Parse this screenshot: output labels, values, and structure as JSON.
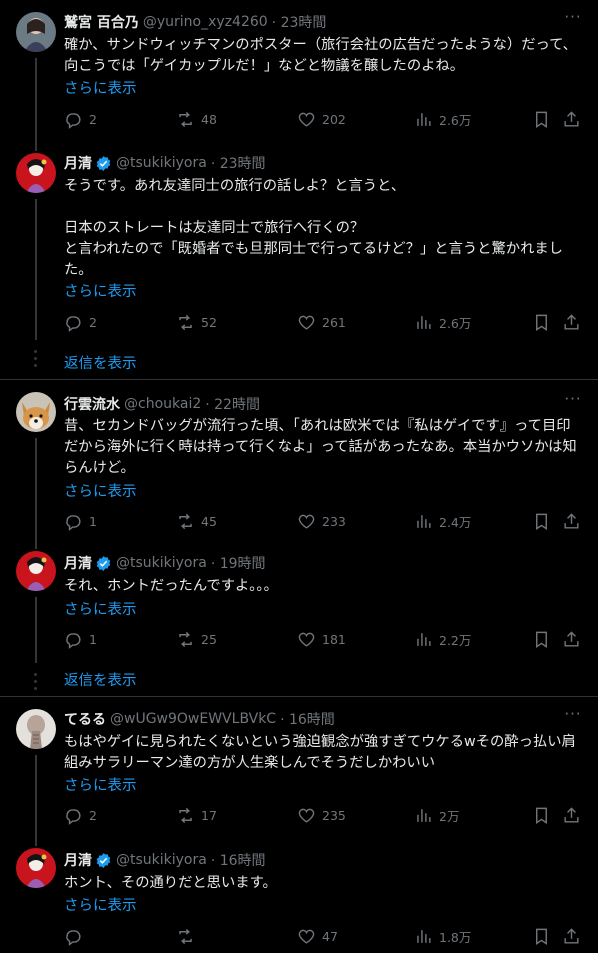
{
  "tweets": [
    {
      "name": "鷲宮 百合乃",
      "handle": "@yurino_xyz4260",
      "time": "· 23時間",
      "text": "確か、サンドウィッチマンのポスター（旅行会社の広告だったような）だって、向こうでは「ゲイカップルだ！」などと物議を醸したのよね。",
      "show_more": "さらに表示",
      "replies": "2",
      "retweets": "48",
      "likes": "202",
      "views": "2.6万"
    },
    {
      "name": "月清",
      "handle": "@tsukikiyora",
      "time": "· 23時間",
      "text": "そうです。あれ友達同士の旅行の話しよ？と言うと、\n\n日本のストレートは友達同士で旅行へ行くの？\nと言われたので「既婚者でも旦那同士で行ってるけど？」と言うと驚かれました。",
      "show_more": "さらに表示",
      "replies": "2",
      "retweets": "52",
      "likes": "261",
      "views": "2.6万"
    },
    {
      "name": "行雲流水",
      "handle": "@choukai2",
      "time": "· 22時間",
      "text": "昔、セカンドバッグが流行った頃、「あれは欧米では『私はゲイです』って目印だから海外に行く時は持って行くなよ」って話があったなあ。本当かウソかは知らんけど。",
      "show_more": "さらに表示",
      "replies": "1",
      "retweets": "45",
      "likes": "233",
      "views": "2.4万"
    },
    {
      "name": "月清",
      "handle": "@tsukikiyora",
      "time": "· 19時間",
      "text": "それ、ホントだったんですよ。。。",
      "show_more": "さらに表示",
      "replies": "1",
      "retweets": "25",
      "likes": "181",
      "views": "2.2万"
    },
    {
      "name": "てるる",
      "handle": "@wUGw9OwEWVLBVkC",
      "time": "· 16時間",
      "text": "もはやゲイに見られたくないという強迫観念が強すぎてウケるwその酔っ払い肩組みサラリーマン達の方が人生楽しんでそうだしかわいい",
      "show_more": "さらに表示",
      "replies": "2",
      "retweets": "17",
      "likes": "235",
      "views": "2万"
    },
    {
      "name": "月清",
      "handle": "@tsukikiyora",
      "time": "· 16時間",
      "text": "ホント、その通りだと思います。",
      "show_more": "さらに表示",
      "replies": "",
      "retweets": "",
      "likes": "47",
      "views": "1.8万"
    }
  ],
  "show_replies_label": "返信を表示",
  "more_glyph": "···",
  "colors": {
    "accent": "#1d9bf0",
    "muted": "#71767b",
    "background": "#000000",
    "verified": "#1d9bf0"
  },
  "icons": [
    "reply-icon",
    "retweet-icon",
    "like-icon",
    "views-icon",
    "bookmark-icon",
    "share-icon",
    "more-icon",
    "verified-badge-icon"
  ]
}
